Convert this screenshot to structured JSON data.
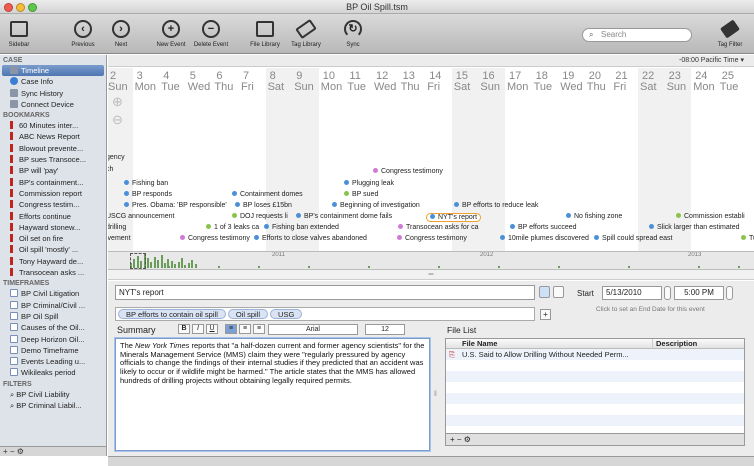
{
  "window": {
    "title": "BP Oil Spill.tsm"
  },
  "toolbar": {
    "sidebar": "Sidebar",
    "previous": "Previous",
    "next": "Next",
    "new_event": "New Event",
    "delete_event": "Delete Event",
    "file_library": "File Library",
    "tag_library": "Tag Library",
    "sync": "Sync",
    "search_placeholder": "Search",
    "tag_filter": "Tag Filter"
  },
  "timezone": "-08:00 Pacific Time",
  "sidebar": {
    "case_header": "CASE",
    "case_items": [
      {
        "label": "Timeline",
        "icon": "timeline-icon"
      },
      {
        "label": "Case Info",
        "icon": "info-icon"
      },
      {
        "label": "Sync History",
        "icon": "sync-icon"
      },
      {
        "label": "Connect Device",
        "icon": "device-icon"
      }
    ],
    "bookmarks_header": "BOOKMARKS",
    "bookmarks": [
      "60 Minutes inter...",
      "ABC News Report",
      "Blowout prevente...",
      "BP sues Transoce...",
      "BP will 'pay'",
      "BP's containment...",
      "Commission report",
      "Congress testim...",
      "Efforts continue",
      "Hayward stonew...",
      "Oil set on fire",
      "Oil spill 'mostly' ...",
      "Tony Hayward de...",
      "Transocean asks ..."
    ],
    "timeframes_header": "TIMEFRAMES",
    "timeframes": [
      "BP Civil Litigation",
      "BP Criminal/Civil ...",
      "BP Oil Spill",
      "Causes of the Oil...",
      "Deep Horizon Oil...",
      "Demo Timeframe",
      "Events Leading u...",
      "Wikileaks period"
    ],
    "filters_header": "FILTERS",
    "filters": [
      "BP Civil Liability",
      "BP Criminal Liabil..."
    ],
    "footer": "+ − ⚙"
  },
  "timeline": {
    "days": [
      {
        "num": "2",
        "name": "Sun"
      },
      {
        "num": "3",
        "name": "Mon"
      },
      {
        "num": "4",
        "name": "Tue"
      },
      {
        "num": "5",
        "name": "Wed"
      },
      {
        "num": "6",
        "name": "Thu"
      },
      {
        "num": "7",
        "name": "Fri"
      },
      {
        "num": "8",
        "name": "Sat"
      },
      {
        "num": "9",
        "name": "Sun"
      },
      {
        "num": "10",
        "name": "Mon"
      },
      {
        "num": "11",
        "name": "Tue"
      },
      {
        "num": "12",
        "name": "Wed"
      },
      {
        "num": "13",
        "name": "Thu"
      },
      {
        "num": "14",
        "name": "Fri"
      },
      {
        "num": "15",
        "name": "Sat"
      },
      {
        "num": "16",
        "name": "Sun"
      },
      {
        "num": "17",
        "name": "Mon"
      },
      {
        "num": "18",
        "name": "Tue"
      },
      {
        "num": "19",
        "name": "Wed"
      },
      {
        "num": "20",
        "name": "Thu"
      },
      {
        "num": "21",
        "name": "Fri"
      },
      {
        "num": "22",
        "name": "Sat"
      },
      {
        "num": "23",
        "name": "Sun"
      },
      {
        "num": "24",
        "name": "Mon"
      },
      {
        "num": "25",
        "name": "Tue"
      }
    ],
    "events": [
      {
        "label": "gency",
        "color": ""
      },
      {
        "label": "ch",
        "color": ""
      },
      {
        "label": "Congress testimony",
        "color": "#d17ad6"
      },
      {
        "label": "Fishing ban",
        "color": "#4a90d9"
      },
      {
        "label": "Plugging leak",
        "color": "#4a90d9"
      },
      {
        "label": "BP responds",
        "color": "#4a90d9"
      },
      {
        "label": "Containment domes",
        "color": "#4a90d9"
      },
      {
        "label": "BP sued",
        "color": "#8bc34a"
      },
      {
        "label": "Pres. Obama: 'BP responsible'",
        "color": "#4a90d9"
      },
      {
        "label": "BP loses £15bn",
        "color": "#4a90d9"
      },
      {
        "label": "Beginning of investigation",
        "color": "#4a90d9"
      },
      {
        "label": "BP efforts to reduce leak",
        "color": "#4a90d9"
      },
      {
        "label": "USCG announcement",
        "color": ""
      },
      {
        "label": "DOJ requests li",
        "color": "#8bc34a"
      },
      {
        "label": "BP's containment dome fails",
        "color": "#4a90d9"
      },
      {
        "label": "NYT's report",
        "color": "#4a90d9"
      },
      {
        "label": "No fishing zone",
        "color": "#4a90d9"
      },
      {
        "label": "Commission establi",
        "color": "#8bc34a"
      },
      {
        "label": "drilling",
        "color": ""
      },
      {
        "label": "1 of 3 leaks ca",
        "color": "#8bc34a"
      },
      {
        "label": "Fishing ban extended",
        "color": "#4a90d9"
      },
      {
        "label": "Transocean asks for ca",
        "color": "#d17ad6"
      },
      {
        "label": "BP efforts succeed",
        "color": "#4a90d9"
      },
      {
        "label": "Slick larger than estimated",
        "color": "#4a90d9"
      },
      {
        "label": "lvement",
        "color": ""
      },
      {
        "label": "Congress testimony",
        "color": "#d17ad6"
      },
      {
        "label": "Efforts to close valves abandoned",
        "color": "#4a90d9"
      },
      {
        "label": "Congress testimony",
        "color": "#d17ad6"
      },
      {
        "label": "10mile plumes discovered",
        "color": "#4a90d9"
      },
      {
        "label": "Spill could spread east",
        "color": "#4a90d9"
      },
      {
        "label": "Tul",
        "color": "#8bc34a"
      }
    ]
  },
  "overview": {
    "years": [
      "2011",
      "2012",
      "2013"
    ]
  },
  "detail": {
    "title": "NYT's report",
    "start_label": "Start",
    "start_date": "5/13/2010",
    "start_time": "5:00 PM",
    "tags": [
      "BP efforts to contain oil spill",
      "Oil spill",
      "USG"
    ],
    "end_hint": "Click to set an End Date for this event",
    "summary_label": "Summary",
    "font": "Arial",
    "font_size": "12",
    "summary_pre": "The ",
    "summary_em": "New York Times",
    "summary_post": " reports that \"a half-dozen current and former agency scientists\" for the Minerals Management Service (MMS) claim they were \"regularly pressured by agency officials to change the findings of their internal studies if they predicted that an accident was likely to occur or if wildlife might be harmed.\" The article states that the MMS has allowed hundreds of drilling projects without obtaining legally required permits.",
    "file_list_label": "File List",
    "file_cols": {
      "name": "File Name",
      "desc": "Description"
    },
    "files": [
      {
        "name": "U.S. Said to Allow Drilling Without Needed Perm...",
        "desc": ""
      }
    ],
    "file_footer": "+ − ⚙"
  }
}
